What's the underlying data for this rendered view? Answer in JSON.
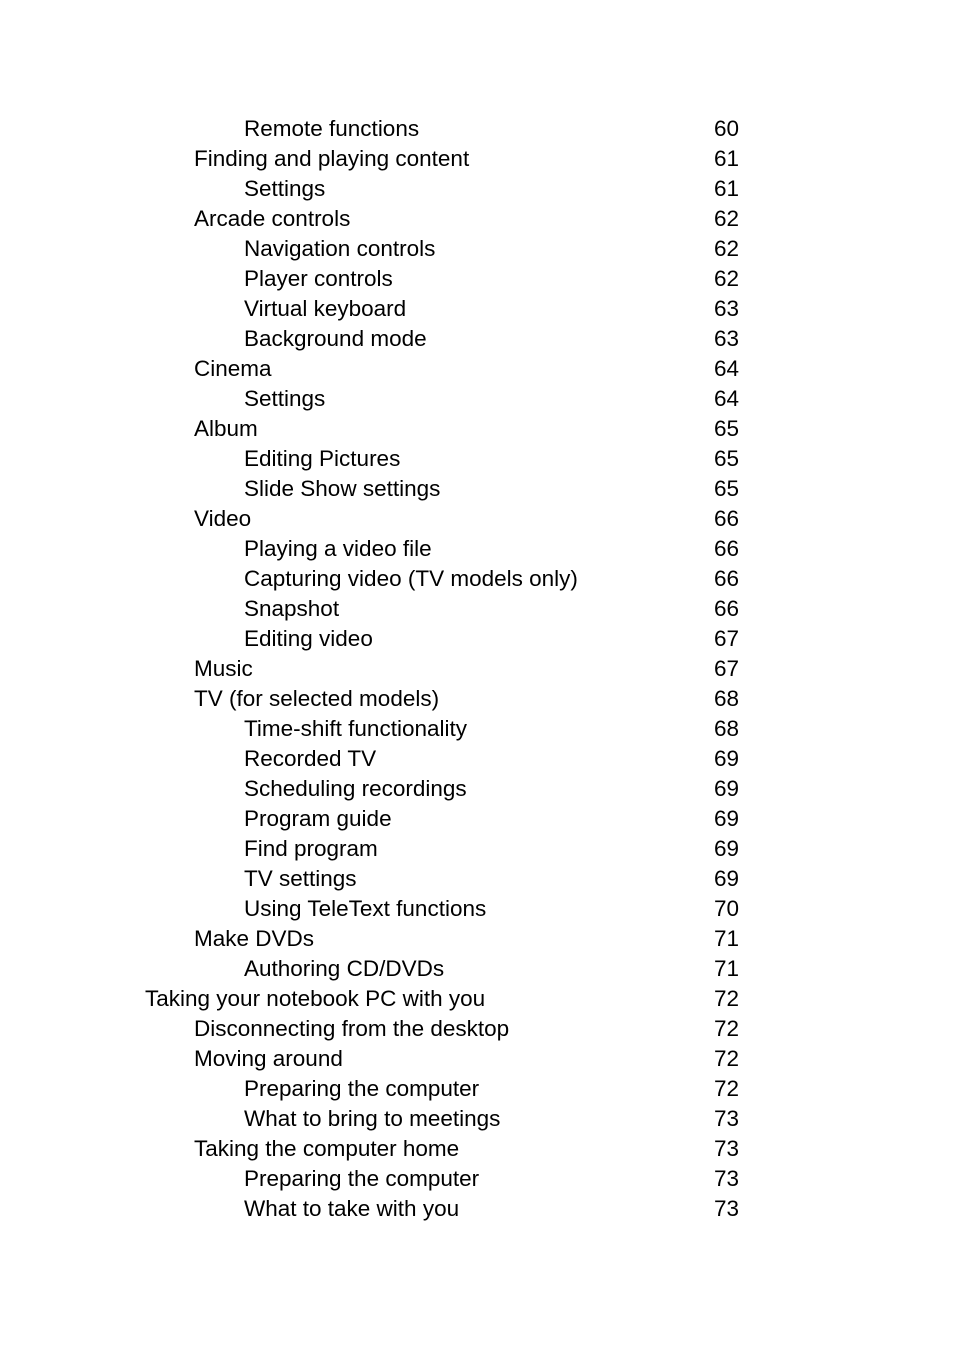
{
  "document": {
    "type": "table-of-contents",
    "text_color": "#000000",
    "background_color": "#ffffff"
  },
  "toc": {
    "entries": [
      {
        "title": "Remote functions",
        "page": "60",
        "level": 2
      },
      {
        "title": "Finding and playing content",
        "page": "61",
        "level": 1
      },
      {
        "title": "Settings",
        "page": "61",
        "level": 2
      },
      {
        "title": "Arcade controls",
        "page": "62",
        "level": 1
      },
      {
        "title": "Navigation controls",
        "page": "62",
        "level": 2
      },
      {
        "title": "Player controls",
        "page": "62",
        "level": 2
      },
      {
        "title": "Virtual keyboard",
        "page": "63",
        "level": 2
      },
      {
        "title": "Background mode",
        "page": "63",
        "level": 2
      },
      {
        "title": "Cinema",
        "page": "64",
        "level": 1
      },
      {
        "title": "Settings",
        "page": "64",
        "level": 2
      },
      {
        "title": "Album",
        "page": "65",
        "level": 1
      },
      {
        "title": "Editing Pictures",
        "page": "65",
        "level": 2
      },
      {
        "title": "Slide Show settings",
        "page": "65",
        "level": 2
      },
      {
        "title": "Video",
        "page": "66",
        "level": 1
      },
      {
        "title": "Playing a video file",
        "page": "66",
        "level": 2
      },
      {
        "title": "Capturing video (TV models only)",
        "page": "66",
        "level": 2
      },
      {
        "title": "Snapshot",
        "page": "66",
        "level": 2
      },
      {
        "title": "Editing video",
        "page": "67",
        "level": 2
      },
      {
        "title": "Music",
        "page": "67",
        "level": 1
      },
      {
        "title": "TV (for selected models)",
        "page": "68",
        "level": 1
      },
      {
        "title": "Time-shift functionality",
        "page": "68",
        "level": 2
      },
      {
        "title": "Recorded TV",
        "page": "69",
        "level": 2
      },
      {
        "title": "Scheduling recordings",
        "page": "69",
        "level": 2
      },
      {
        "title": "Program guide",
        "page": "69",
        "level": 2
      },
      {
        "title": "Find program",
        "page": "69",
        "level": 2
      },
      {
        "title": "TV settings",
        "page": "69",
        "level": 2
      },
      {
        "title": "Using TeleText functions",
        "page": "70",
        "level": 2
      },
      {
        "title": "Make DVDs",
        "page": "71",
        "level": 1
      },
      {
        "title": "Authoring CD/DVDs",
        "page": "71",
        "level": 2
      },
      {
        "title": "Taking your notebook PC with you",
        "page": "72",
        "level": 0
      },
      {
        "title": "Disconnecting from the desktop",
        "page": "72",
        "level": 1
      },
      {
        "title": "Moving around",
        "page": "72",
        "level": 1
      },
      {
        "title": "Preparing the computer",
        "page": "72",
        "level": 2
      },
      {
        "title": "What to bring to meetings",
        "page": "73",
        "level": 2
      },
      {
        "title": "Taking the computer home",
        "page": "73",
        "level": 1
      },
      {
        "title": "Preparing the computer",
        "page": "73",
        "level": 2
      },
      {
        "title": "What to take with you",
        "page": "73",
        "level": 2
      }
    ]
  }
}
